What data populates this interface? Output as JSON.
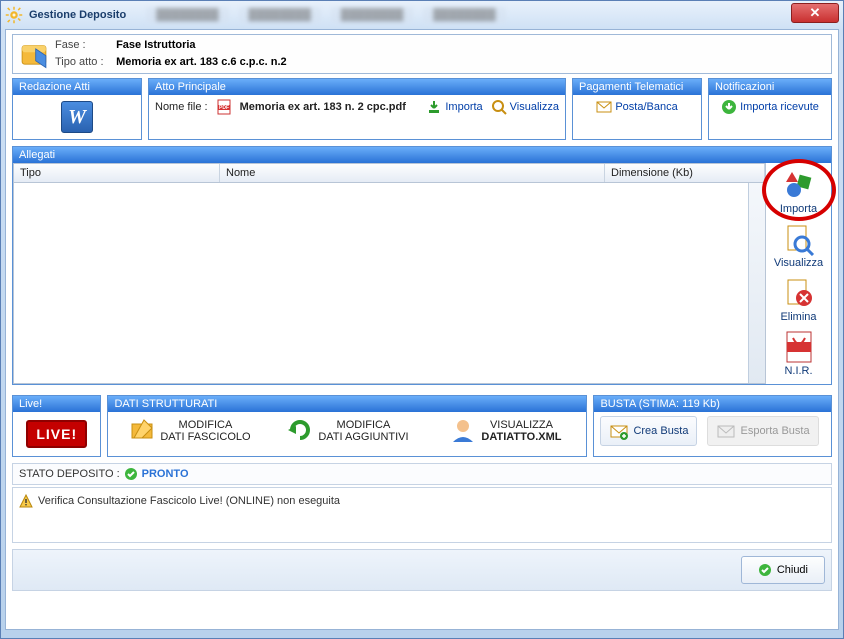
{
  "title": "Gestione Deposito",
  "header": {
    "fase_label": "Fase :",
    "fase_value": "Fase Istruttoria",
    "tipo_label": "Tipo atto :",
    "tipo_value": "Memoria ex art. 183 c.6 c.p.c. n.2"
  },
  "panels": {
    "redazione": {
      "title": "Redazione Atti"
    },
    "atto": {
      "title": "Atto Principale",
      "nome_file_label": "Nome file :",
      "nome_file_value": "Memoria ex art. 183 n. 2 cpc.pdf",
      "importa": "Importa",
      "visualizza": "Visualizza"
    },
    "pagamenti": {
      "title": "Pagamenti Telematici",
      "btn": "Posta/Banca"
    },
    "notifiche": {
      "title": "Notificazioni",
      "btn": "Importa ricevute"
    }
  },
  "allegati": {
    "title": "Allegati",
    "columns": {
      "tipo": "Tipo",
      "nome": "Nome",
      "dimensione": "Dimensione (Kb)"
    },
    "side": {
      "importa": "Importa",
      "visualizza": "Visualizza",
      "elimina": "Elimina",
      "nir": "N.I.R."
    }
  },
  "live": {
    "title": "Live!",
    "badge": "LIVE!"
  },
  "dati": {
    "title": "DATI STRUTTURATI",
    "fascicolo_l1": "MODIFICA",
    "fascicolo_l2": "DATI FASCICOLO",
    "aggiuntivi_l1": "MODIFICA",
    "aggiuntivi_l2": "DATI AGGIUNTIVI",
    "vis_l1": "VISUALIZZA",
    "vis_l2": "DATIATTO.XML"
  },
  "busta": {
    "title": "BUSTA (STIMA: 119 Kb)",
    "crea": "Crea Busta",
    "esporta": "Esporta Busta"
  },
  "status": {
    "label": "STATO DEPOSITO :",
    "value": "PRONTO"
  },
  "warning": "Verifica Consultazione Fascicolo Live! (ONLINE) non eseguita",
  "close": "Chiudi"
}
